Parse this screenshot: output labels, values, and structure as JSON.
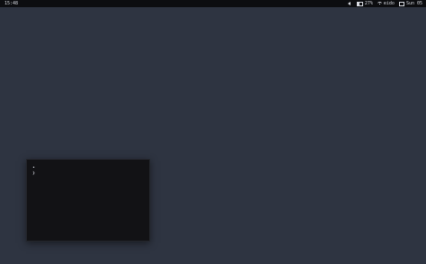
{
  "topbar": {
    "time": "15:48",
    "battery_label": "27%",
    "wifi_label": "eido",
    "date_label": "Sun 05"
  },
  "terminal": {
    "lines": [
      "•",
      "❯"
    ]
  },
  "colors": {
    "desktop_bg": "#2e3441",
    "topbar_bg": "#0c0d10",
    "terminal_bg": "#121215"
  },
  "icons": [
    "volume-icon",
    "battery-icon",
    "wifi-icon",
    "calendar-icon"
  ]
}
